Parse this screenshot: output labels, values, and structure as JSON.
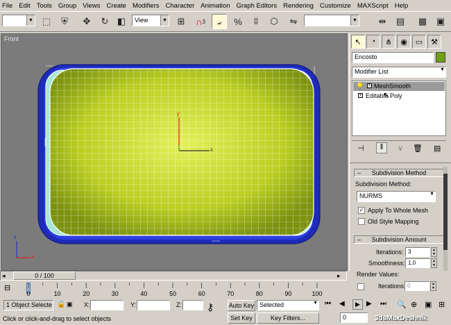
{
  "menu": [
    "File",
    "Edit",
    "Tools",
    "Group",
    "Views",
    "Create",
    "Modifiers",
    "Character",
    "Animation",
    "Graph Editors",
    "Rendering",
    "Customize",
    "MAXScript",
    "Help"
  ],
  "toolbar": {
    "selection_filter": "",
    "ref_coord": "View",
    "named_selection": "",
    "snap_label": "3"
  },
  "viewport": {
    "label": "Front",
    "gizmo_axis_y": "y",
    "gizmo_axis_x": "x",
    "corner_axis_z": "z",
    "corner_axis_x": "x"
  },
  "command_panel": {
    "object_name": "Encosto",
    "object_color": "#6f9f14",
    "modifier_list_label": "Modifier List",
    "stack": [
      {
        "label": "MeshSmooth",
        "selected": true
      },
      {
        "label": "Editable Poly",
        "selected": false
      }
    ],
    "rollout_subdivision_method": {
      "title": "Subdivision Method",
      "field_label": "Subdivision Method:",
      "method_value": "NURMS",
      "apply_whole_mesh": "Apply To Whole Mesh",
      "apply_whole_mesh_checked": true,
      "old_style_mapping": "Old Style Mapping",
      "old_style_mapping_checked": false
    },
    "rollout_subdivision_amount": {
      "title": "Subdivision Amount",
      "iterations_label": "Iterations:",
      "iterations_value": "3",
      "smoothness_label": "Smoothness:",
      "smoothness_value": "1,0",
      "render_values_label": "Render Values:",
      "render_iterations_label": "Iterations:",
      "render_iterations_value": "0"
    }
  },
  "timeline": {
    "frame_slider": "0 / 100",
    "ticks": [
      "0",
      "10",
      "20",
      "30",
      "40",
      "50",
      "60",
      "70",
      "80",
      "90",
      "100"
    ]
  },
  "status": {
    "selection_count": "1 Object Selecte",
    "x_label": "X:",
    "y_label": "Y:",
    "z_label": "Z:",
    "prompt": "Click or click-and-drag to select objects",
    "auto_key": "Auto Key",
    "set_key": "Set Key",
    "key_mode_value": "Selected",
    "key_filters": "Key Filters...",
    "current_frame": "0",
    "watermark": "3dsMaxDeshnik"
  }
}
